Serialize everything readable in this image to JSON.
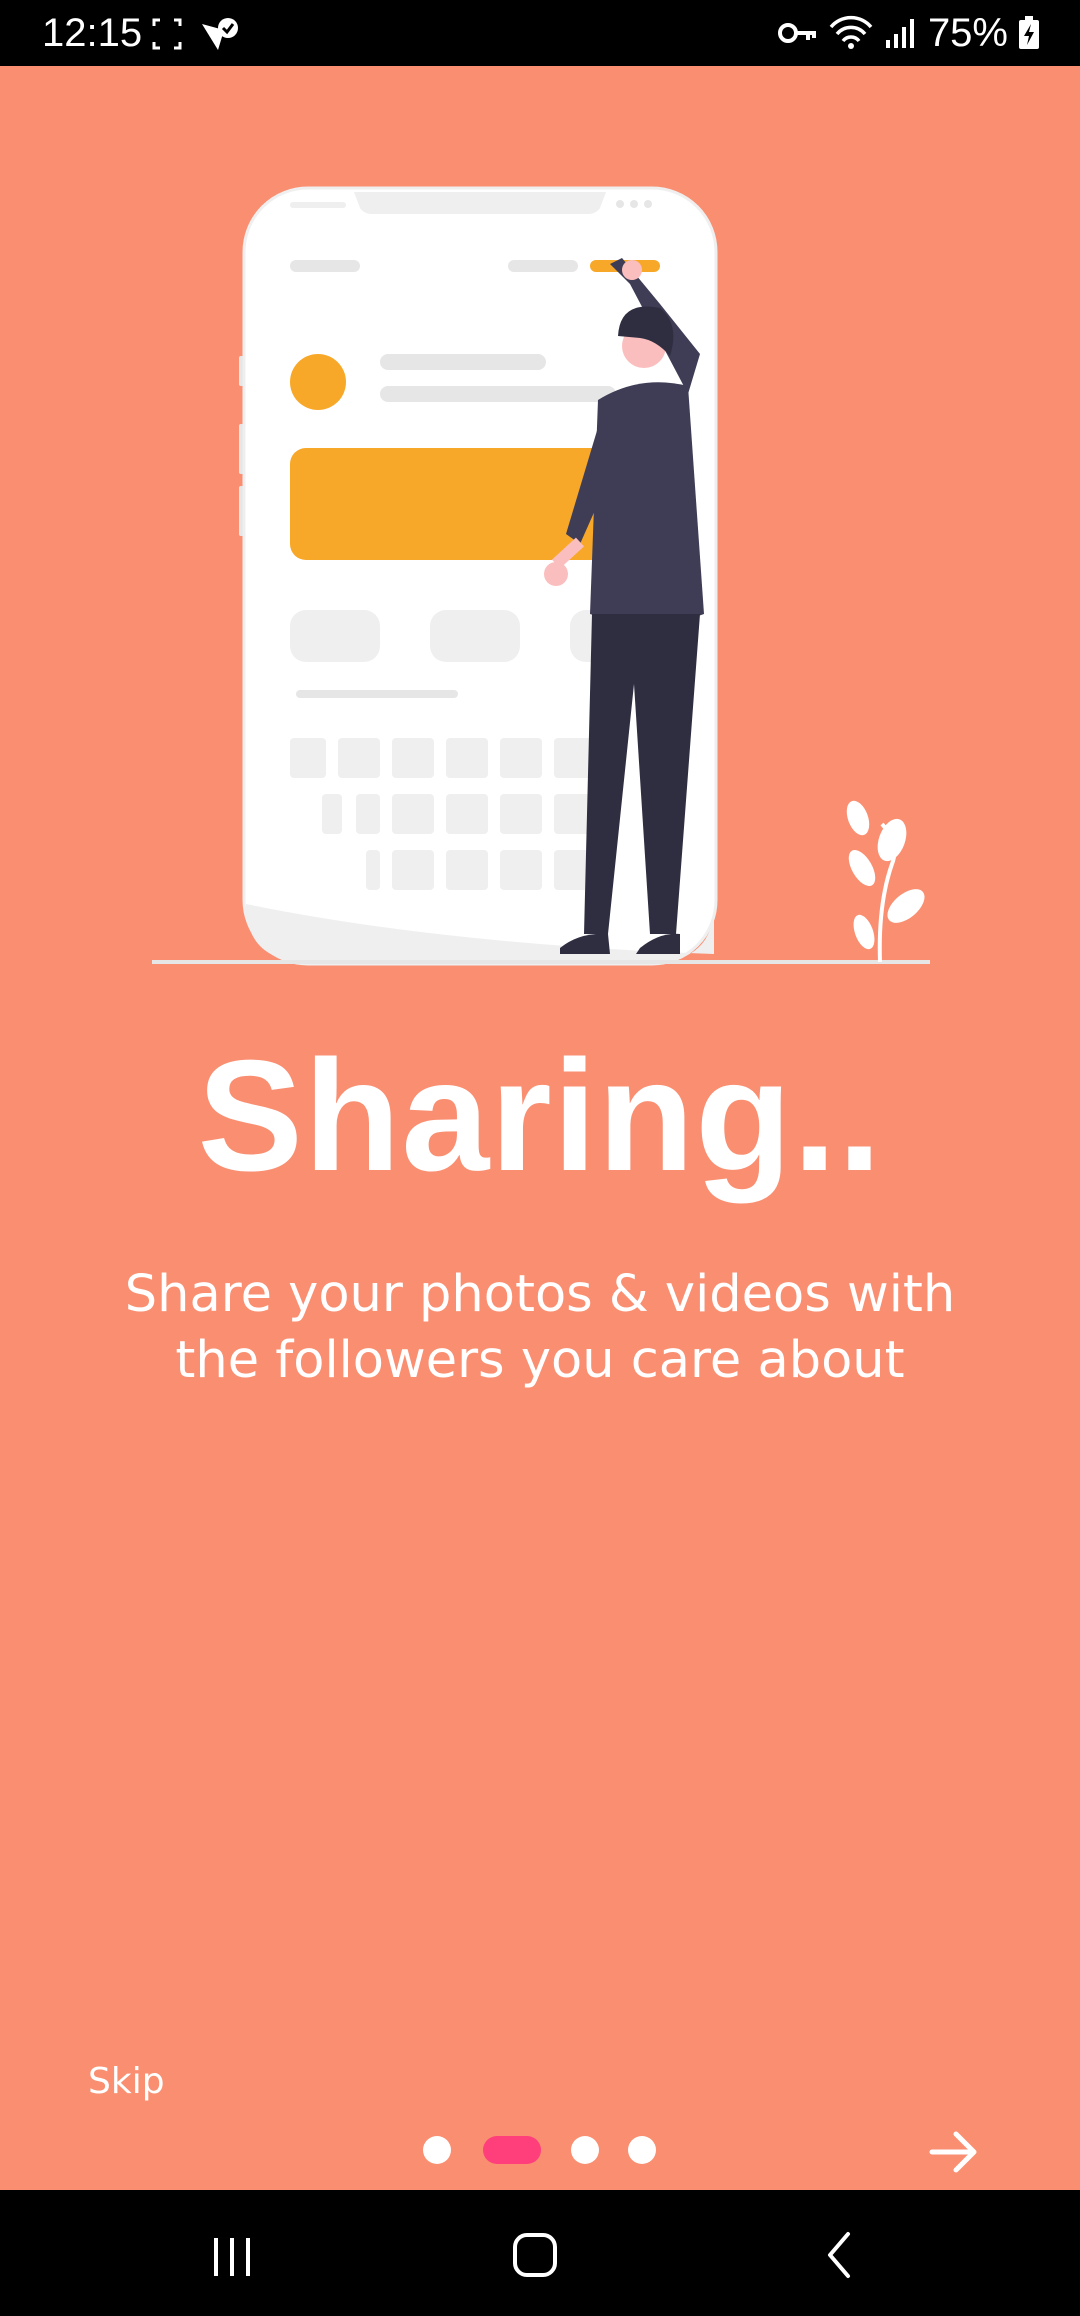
{
  "status_bar": {
    "time": "12:15",
    "battery": "75%",
    "icons_left": [
      "screenshot-frame-icon",
      "check-badge-icon"
    ],
    "icons_right": [
      "vpn-key-icon",
      "wifi-icon",
      "signal-icon",
      "battery-charging-icon"
    ]
  },
  "onboarding": {
    "title": "Sharing..",
    "subtitle": "Share  your photos & videos with\nthe followers you care about",
    "skip_label": "Skip",
    "page_count": 4,
    "active_page": 2
  },
  "colors": {
    "background": "#fa8e71",
    "accent_dot": "#ff3f7c",
    "illustration_accent": "#f8a829",
    "person_dark": "#3f3d56"
  },
  "system_nav": {
    "buttons": [
      "recents-icon",
      "home-icon",
      "back-icon"
    ]
  }
}
